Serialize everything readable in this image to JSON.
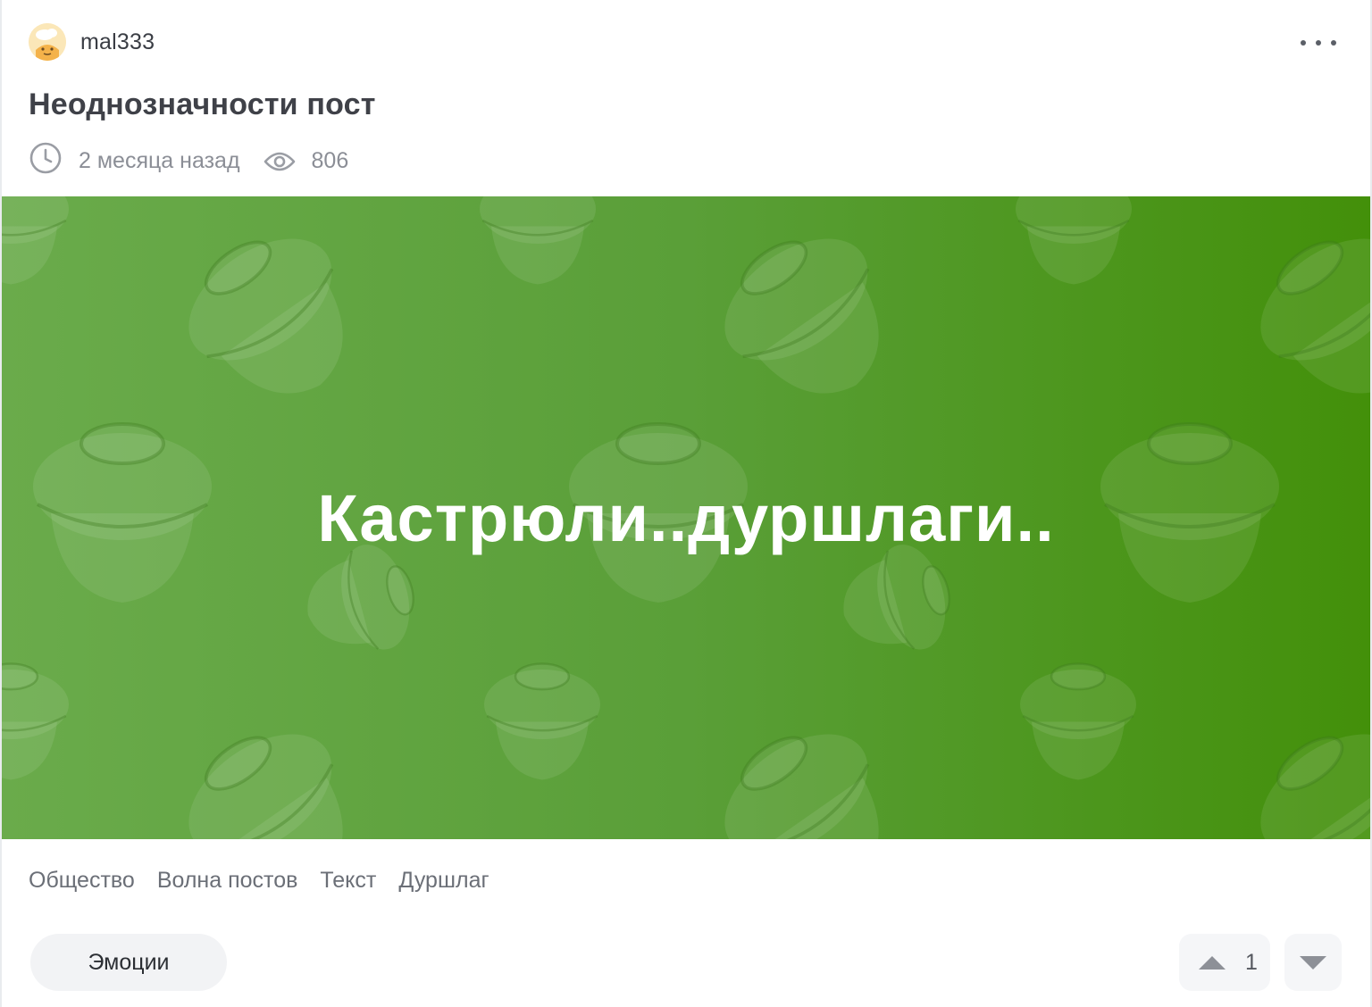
{
  "author": {
    "name": "mal333",
    "avatar_icon": "chef-avatar-icon"
  },
  "post": {
    "title": "Неоднозначности пост",
    "time_ago": "2 месяца назад",
    "views": "806",
    "banner_text": "Кастрюли..дуршлаги..",
    "banner_colors": [
      "#6aab4b",
      "#43900a"
    ]
  },
  "tags": [
    "Общество",
    "Волна постов",
    "Текст",
    "Дуршлаг"
  ],
  "actions": {
    "emotions_label": "Эмоции",
    "vote_count": "1",
    "more_icon": "more-dots-icon",
    "upvote_icon": "triangle-up-icon",
    "downvote_icon": "triangle-down-icon"
  }
}
